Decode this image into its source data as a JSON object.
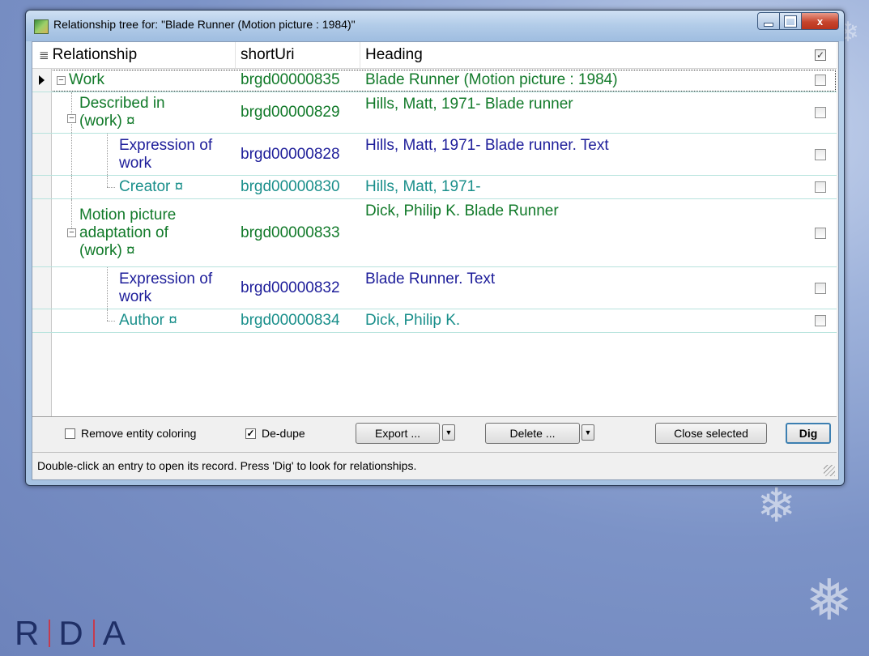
{
  "window": {
    "title": "Relationship tree for: \"Blade Runner (Motion picture : 1984)\"",
    "min_label": "",
    "max_label": "",
    "close_label": "x"
  },
  "grid": {
    "columns": {
      "relationship": "Relationship",
      "short_uri": "shortUri",
      "heading": "Heading"
    },
    "rows": [
      {
        "relationship": "Work",
        "short_uri": "brgd00000835",
        "heading": "Blade Runner (Motion picture : 1984)",
        "checked": false,
        "color": "#127a2a"
      },
      {
        "relationship": "Described in (work) ¤",
        "short_uri": "brgd00000829",
        "heading": "Hills, Matt, 1971- Blade runner",
        "checked": false,
        "color": "#127a2a"
      },
      {
        "relationship": "Expression of work",
        "short_uri": "brgd00000828",
        "heading": "Hills, Matt, 1971- Blade runner. Text",
        "checked": false,
        "color": "#1e1e9a"
      },
      {
        "relationship": "Creator ¤",
        "short_uri": "brgd00000830",
        "heading": "Hills, Matt, 1971-",
        "checked": false,
        "color": "#1a8f8b"
      },
      {
        "relationship": "Motion picture adaptation of (work) ¤",
        "short_uri": "brgd00000833",
        "heading": "Dick, Philip K. Blade Runner",
        "checked": false,
        "color": "#127a2a"
      },
      {
        "relationship": "Expression of work",
        "short_uri": "brgd00000832",
        "heading": "Blade Runner. Text",
        "checked": false,
        "color": "#1e1e9a"
      },
      {
        "relationship": "Author ¤",
        "short_uri": "brgd00000834",
        "heading": "Dick, Philip K.",
        "checked": false,
        "color": "#1a8f8b"
      }
    ]
  },
  "toolbar": {
    "remove_coloring_label": "Remove entity coloring",
    "remove_coloring_checked": false,
    "dedupe_label": "De-dupe",
    "dedupe_checked": true,
    "export_label": "Export ...",
    "delete_label": "Delete ...",
    "close_selected_label": "Close selected",
    "dig_label": "Dig"
  },
  "status": {
    "text": "Double-click an entry to open its record. Press 'Dig' to look for relationships."
  },
  "logo": {
    "text": "RDA"
  }
}
